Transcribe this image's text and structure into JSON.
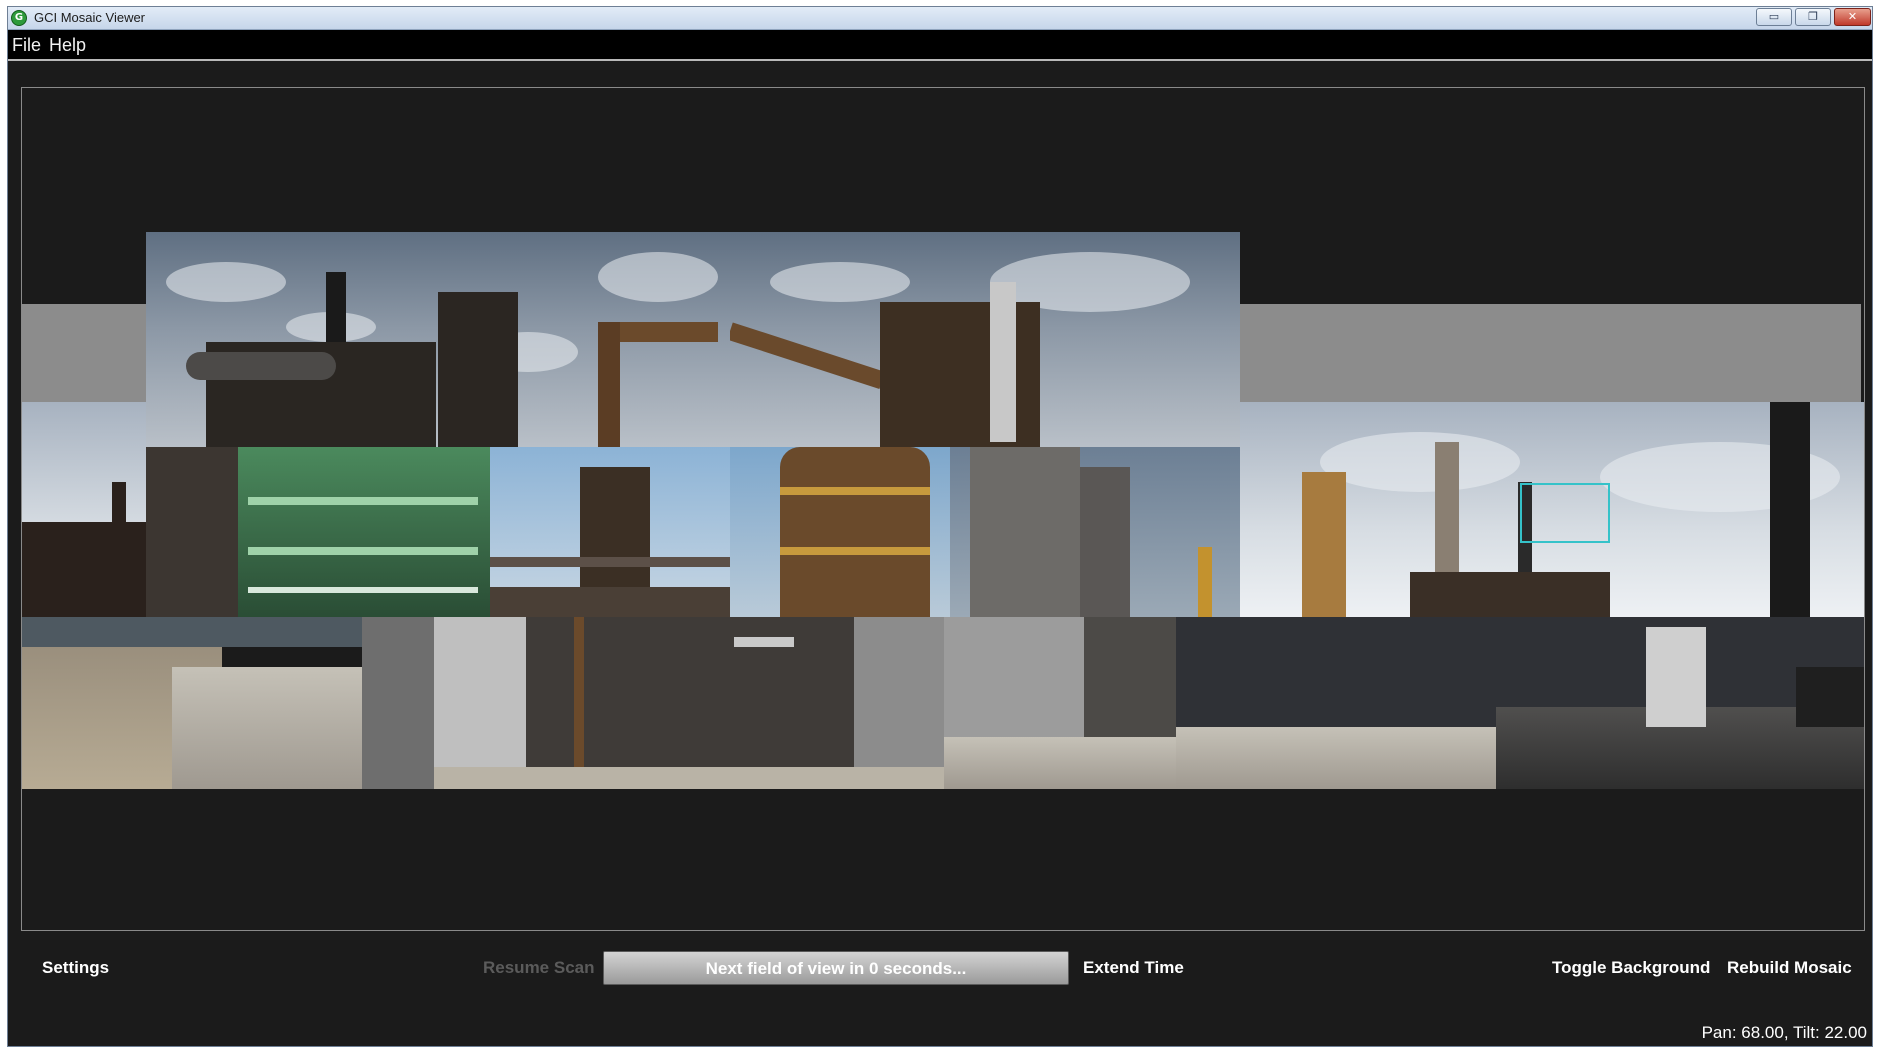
{
  "window": {
    "title": "GCI Mosaic Viewer",
    "minimize": "▭",
    "restore": "❐",
    "close": "✕"
  },
  "menu": {
    "file": "File",
    "help": "Help"
  },
  "mosaic": {
    "description_icon": "panorama-image",
    "selection_color": "#35c2c9"
  },
  "controls": {
    "settings": "Settings",
    "resume_scan": "Resume Scan",
    "progress_text": "Next field of view in 0 seconds...",
    "progress_fraction": 1.0,
    "extend_time": "Extend Time",
    "toggle_background": "Toggle Background",
    "rebuild_mosaic": "Rebuild Mosaic"
  },
  "status": {
    "pan_tilt": "Pan: 68.00, Tilt: 22.00"
  },
  "colors": {
    "window_bg": "#1b1b1b",
    "disabled_text": "#5b5b5b",
    "button_text": "#ffffff"
  }
}
